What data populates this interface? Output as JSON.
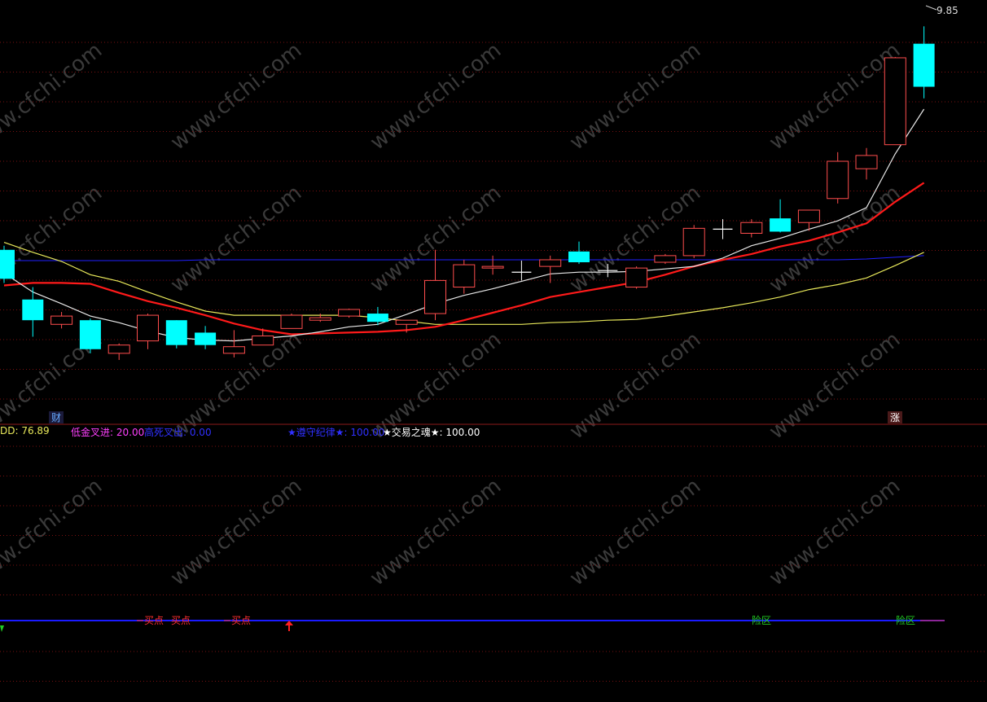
{
  "colors": {
    "background": "#000000",
    "grid": "#7a1010",
    "divider": "#8b1a1a",
    "up_candle": "#ff4d4d",
    "down_candle": "#00ffff",
    "cross_candle": "#ffffff",
    "ma_white": "#e8e8e8",
    "ma_red": "#ff1a1a",
    "ma_yellow": "#e8e85a",
    "ma_blue": "#2020ff",
    "signal_line": "#1a1aff",
    "buy_text": "#ff3030",
    "risk_text": "#22cc22",
    "watermark": "#3a3a3a"
  },
  "price_panel": {
    "high_marker": "9.85",
    "left_badge": "财",
    "right_badge": "涨"
  },
  "indicator_panel": {
    "labels": [
      {
        "text": "DD: 76.89",
        "color": "#e8e85a"
      },
      {
        "text": "低金叉进: 20.00",
        "color": "#ff40ff"
      },
      {
        "text": "高死叉出: 0.00",
        "color": "#3030ff"
      },
      {
        "text": "★遵守纪律★: 100.00",
        "color": "#3030ff"
      },
      {
        "text": "★交易之魂★: 100.00",
        "color": "#ffffff"
      }
    ],
    "signals": [
      {
        "text": "买点",
        "type": "buy"
      },
      {
        "text": "买点",
        "type": "buy"
      },
      {
        "text": "买点",
        "type": "buy"
      },
      {
        "text": "险区",
        "type": "risk"
      },
      {
        "text": "险区",
        "type": "risk"
      }
    ]
  },
  "watermark_text": "www.cfchi.com",
  "chart_data": {
    "type": "candlestick",
    "ylim": [
      5.2,
      10.05
    ],
    "candles": [
      {
        "o": 7.15,
        "h": 7.2,
        "l": 6.75,
        "c": 6.8
      },
      {
        "o": 6.55,
        "h": 6.7,
        "l": 6.1,
        "c": 6.3
      },
      {
        "o": 6.25,
        "h": 6.4,
        "l": 6.2,
        "c": 6.35
      },
      {
        "o": 6.3,
        "h": 6.32,
        "l": 5.9,
        "c": 5.95
      },
      {
        "o": 5.9,
        "h": 6.02,
        "l": 5.82,
        "c": 6.0
      },
      {
        "o": 6.05,
        "h": 6.38,
        "l": 5.95,
        "c": 6.36
      },
      {
        "o": 6.3,
        "h": 6.3,
        "l": 5.96,
        "c": 6.0
      },
      {
        "o": 6.15,
        "h": 6.23,
        "l": 5.95,
        "c": 6.0
      },
      {
        "o": 5.9,
        "h": 6.18,
        "l": 5.85,
        "c": 5.98
      },
      {
        "o": 6.0,
        "h": 6.2,
        "l": 6.0,
        "c": 6.11
      },
      {
        "o": 6.2,
        "h": 6.38,
        "l": 6.2,
        "c": 6.36
      },
      {
        "o": 6.3,
        "h": 6.38,
        "l": 6.28,
        "c": 6.33
      },
      {
        "o": 6.35,
        "h": 6.44,
        "l": 6.33,
        "c": 6.43
      },
      {
        "o": 6.38,
        "h": 6.46,
        "l": 6.24,
        "c": 6.28
      },
      {
        "o": 6.25,
        "h": 6.3,
        "l": 6.15,
        "c": 6.3
      },
      {
        "o": 6.38,
        "h": 7.15,
        "l": 6.3,
        "c": 6.78
      },
      {
        "o": 6.7,
        "h": 7.03,
        "l": 6.62,
        "c": 6.97
      },
      {
        "o": 6.93,
        "h": 7.08,
        "l": 6.85,
        "c": 6.95
      },
      {
        "o": 6.88,
        "h": 7.02,
        "l": 6.78,
        "c": 6.88
      },
      {
        "o": 6.95,
        "h": 7.08,
        "l": 6.75,
        "c": 7.03
      },
      {
        "o": 7.13,
        "h": 7.25,
        "l": 6.98,
        "c": 7.0
      },
      {
        "o": 6.9,
        "h": 6.98,
        "l": 6.82,
        "c": 6.9
      },
      {
        "o": 6.7,
        "h": 6.95,
        "l": 6.68,
        "c": 6.93
      },
      {
        "o": 7.0,
        "h": 7.1,
        "l": 6.98,
        "c": 7.08
      },
      {
        "o": 7.08,
        "h": 7.45,
        "l": 7.05,
        "c": 7.41
      },
      {
        "o": 7.4,
        "h": 7.52,
        "l": 7.28,
        "c": 7.4
      },
      {
        "o": 7.35,
        "h": 7.52,
        "l": 7.3,
        "c": 7.48
      },
      {
        "o": 7.53,
        "h": 7.76,
        "l": 7.36,
        "c": 7.37
      },
      {
        "o": 7.48,
        "h": 7.63,
        "l": 7.38,
        "c": 7.63
      },
      {
        "o": 7.77,
        "h": 8.33,
        "l": 7.71,
        "c": 8.22
      },
      {
        "o": 8.13,
        "h": 8.38,
        "l": 8.0,
        "c": 8.29
      },
      {
        "o": 8.42,
        "h": 9.48,
        "l": 8.42,
        "c": 9.47
      },
      {
        "o": 9.64,
        "h": 9.85,
        "l": 8.98,
        "c": 9.12
      }
    ],
    "ma_white": [
      6.87,
      6.64,
      6.5,
      6.35,
      6.27,
      6.17,
      6.09,
      6.06,
      6.05,
      6.08,
      6.11,
      6.16,
      6.22,
      6.25,
      6.37,
      6.5,
      6.6,
      6.68,
      6.77,
      6.86,
      6.88,
      6.88,
      6.89,
      6.92,
      6.95,
      7.05,
      7.2,
      7.29,
      7.4,
      7.5,
      7.66,
      8.31,
      8.85
    ],
    "ma_red": [
      6.72,
      6.75,
      6.75,
      6.74,
      6.63,
      6.53,
      6.45,
      6.36,
      6.26,
      6.18,
      6.13,
      6.14,
      6.15,
      6.16,
      6.18,
      6.22,
      6.3,
      6.39,
      6.48,
      6.58,
      6.64,
      6.7,
      6.76,
      6.85,
      6.95,
      7.03,
      7.1,
      7.19,
      7.26,
      7.36,
      7.47,
      7.73,
      7.96
    ],
    "ma_yellow": [
      7.24,
      7.12,
      7.01,
      6.85,
      6.77,
      6.64,
      6.52,
      6.41,
      6.36,
      6.36,
      6.36,
      6.36,
      6.36,
      6.33,
      6.29,
      6.25,
      6.25,
      6.25,
      6.25,
      6.27,
      6.28,
      6.3,
      6.31,
      6.35,
      6.4,
      6.45,
      6.51,
      6.58,
      6.67,
      6.73,
      6.81,
      6.96,
      7.12
    ],
    "ma_blue": [
      7.02,
      7.02,
      7.02,
      7.02,
      7.02,
      7.02,
      7.02,
      7.03,
      7.03,
      7.03,
      7.03,
      7.03,
      7.03,
      7.03,
      7.03,
      7.03,
      7.03,
      7.03,
      7.03,
      7.03,
      7.03,
      7.03,
      7.03,
      7.03,
      7.03,
      7.03,
      7.03,
      7.03,
      7.03,
      7.03,
      7.04,
      7.06,
      7.08
    ]
  }
}
